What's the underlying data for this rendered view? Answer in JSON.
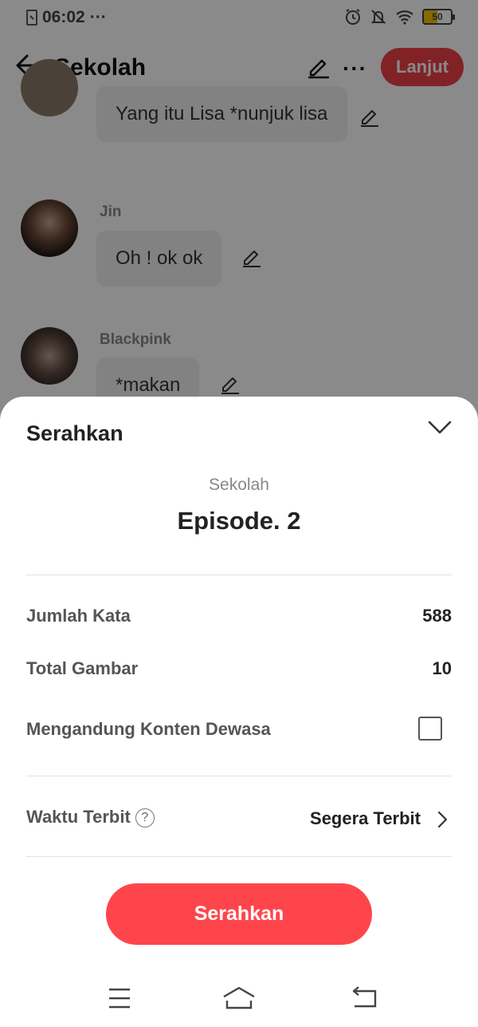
{
  "status_bar": {
    "time": "06:02",
    "dots": "···",
    "battery_level": "50",
    "icons": [
      "sim-icon",
      "alarm-icon",
      "mute-icon",
      "wifi-icon",
      "battery-icon"
    ]
  },
  "app_bar": {
    "back_icon": "arrow-left-icon",
    "title": "Sekolah",
    "edit_icon": "pencil-icon",
    "more_icon": "more-dots-icon",
    "more_label": "···",
    "next_label": "Lanjut"
  },
  "chat": {
    "messages": [
      {
        "name": "",
        "text": "Yang itu Lisa *nunjuk lisa"
      },
      {
        "name": "Jin",
        "text": "Oh ! ok ok"
      },
      {
        "name": "Blackpink",
        "text": "*makan"
      }
    ]
  },
  "sheet": {
    "title": "Serahkan",
    "collapse_icon": "chevron-down-icon",
    "series": "Sekolah",
    "episode": "Episode. 2",
    "word_count_label": "Jumlah Kata",
    "word_count_value": "588",
    "images_label": "Total Gambar",
    "images_value": "10",
    "mature_label": "Mengandung Konten Dewasa",
    "mature_checked": false,
    "publish_label": "Waktu Terbit",
    "publish_help": "?",
    "publish_value": "Segera Terbit",
    "submit_label": "Serahkan"
  },
  "navigation": {
    "items": [
      "menu-icon",
      "home-icon",
      "back-icon"
    ]
  },
  "colors": {
    "accent": "#ff454c",
    "lanjut": "#ee4047"
  }
}
